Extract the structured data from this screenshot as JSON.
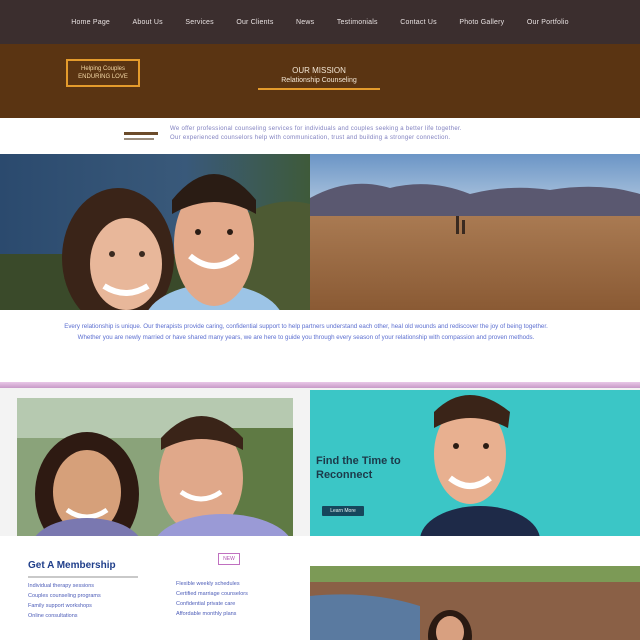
{
  "nav": {
    "items": [
      "Home Page",
      "About Us",
      "Services",
      "Our Clients",
      "News",
      "Testimonials",
      "Contact Us",
      "Photo Gallery",
      "Our Portfolio"
    ]
  },
  "hero": {
    "badge_line1": "Helping Couples",
    "badge_line2": "ENDURING LOVE",
    "title": "OUR MISSION",
    "subtitle": "Relationship Counseling"
  },
  "intro": {
    "text_line1": "We offer professional counseling services for individuals and couples seeking a better life together.",
    "text_line2": "Our experienced counselors help with communication, trust and building a stronger connection."
  },
  "mid_text": {
    "paragraph": "Every relationship is unique. Our therapists provide caring, confidential support to help partners understand each other, heal old wounds and rediscover the joy of being together. Whether you are newly married or have shared many years, we are here to guide you through every season of your relationship with compassion and proven methods."
  },
  "promo": {
    "headline": "Find the Time to Reconnect",
    "cta": "Learn More"
  },
  "info": {
    "heading": "Get A Membership",
    "tag": "NEW",
    "col_a": [
      "Individual therapy sessions",
      "Couples counseling programs",
      "Family support workshops",
      "Online consultations"
    ],
    "col_b": [
      "Flexible weekly schedules",
      "Certified marriage counselors",
      "Confidential private care",
      "Affordable monthly plans"
    ]
  },
  "colors": {
    "nav_bg": "#3b2e2e",
    "hero_bg": "#5a3412",
    "accent": "#e49b2c",
    "link_text": "#5c6fd0",
    "promo_bg": "#3bc6c6",
    "divider": "#c89ac8"
  }
}
